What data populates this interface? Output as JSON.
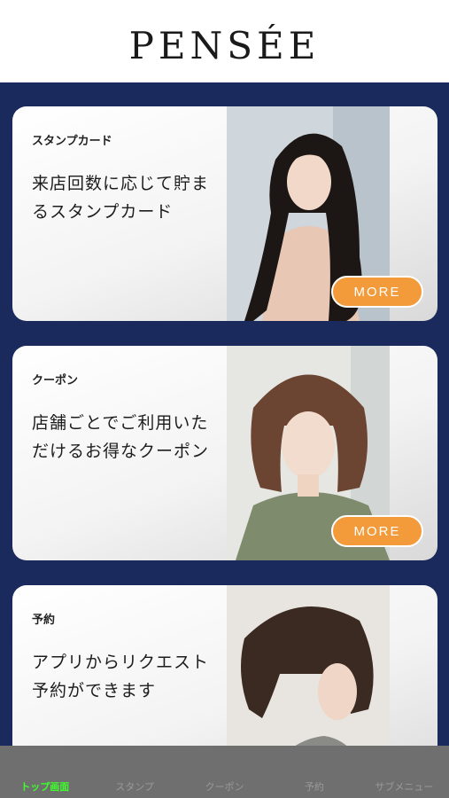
{
  "header": {
    "logo_text": "PENSÉE"
  },
  "cards": [
    {
      "label": "スタンプカード",
      "desc_line1": "来店回数に応じて貯ま",
      "desc_line2": "るスタンプカード",
      "button": "MORE"
    },
    {
      "label": "クーポン",
      "desc_line1": "店舗ごとでご利用いた",
      "desc_line2": "だけるお得なクーポン",
      "button": "MORE"
    },
    {
      "label": "予約",
      "desc_line1": "アプリからリクエスト",
      "desc_line2": "予約ができます"
    }
  ],
  "tabbar": {
    "items": [
      "トップ画面",
      "スタンプ",
      "クーポン",
      "予約",
      "サブメニュー"
    ],
    "active_index": 0
  },
  "colors": {
    "navy_background": "#1a2a5c",
    "more_button": "#f39a3a",
    "tab_active": "#3dff2a",
    "tabbar_bg": "#6f6f6f"
  }
}
